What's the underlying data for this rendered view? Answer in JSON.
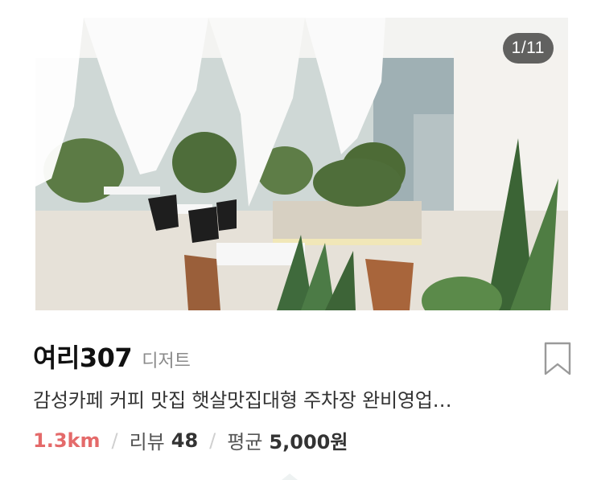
{
  "photo": {
    "counter": "1/11"
  },
  "place": {
    "name": "여리307",
    "category": "디저트",
    "description": "감성카페 커피 맛집 햇살맛집대형 주차장 완비영업…"
  },
  "meta": {
    "distance": "1.3km",
    "separator": "/",
    "review_label": "리뷰",
    "review_count": "48",
    "price_label": "평균",
    "price_value": "5,000원"
  },
  "icons": {
    "bookmark": "bookmark-icon"
  },
  "colors": {
    "distance": "#e46a6a",
    "bookmark_stroke": "#9a9a9a"
  }
}
